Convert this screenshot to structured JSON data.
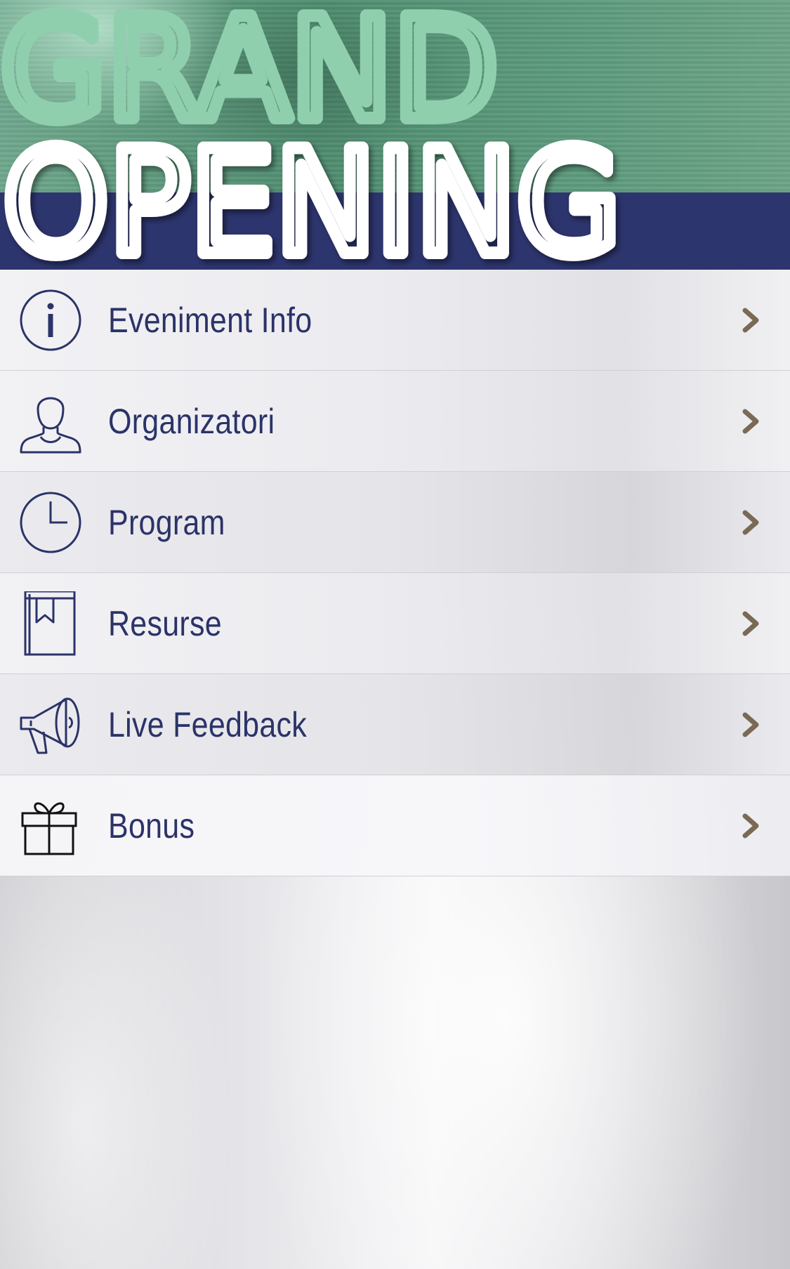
{
  "header": {
    "title_line1": "GRAND",
    "title_line2": "OPENING"
  },
  "menu": {
    "items": [
      {
        "label": "Eveniment Info",
        "icon": "info-icon"
      },
      {
        "label": "Organizatori",
        "icon": "person-icon"
      },
      {
        "label": "Program",
        "icon": "clock-icon"
      },
      {
        "label": "Resurse",
        "icon": "bookmark-book-icon"
      },
      {
        "label": "Live Feedback",
        "icon": "megaphone-icon"
      },
      {
        "label": "Bonus",
        "icon": "gift-icon"
      }
    ]
  },
  "colors": {
    "navy": "#2d356e",
    "green": "#5c9a7d",
    "title_green": "#8fcfae",
    "label": "#2b3368",
    "arrow": "#7a6a55"
  }
}
